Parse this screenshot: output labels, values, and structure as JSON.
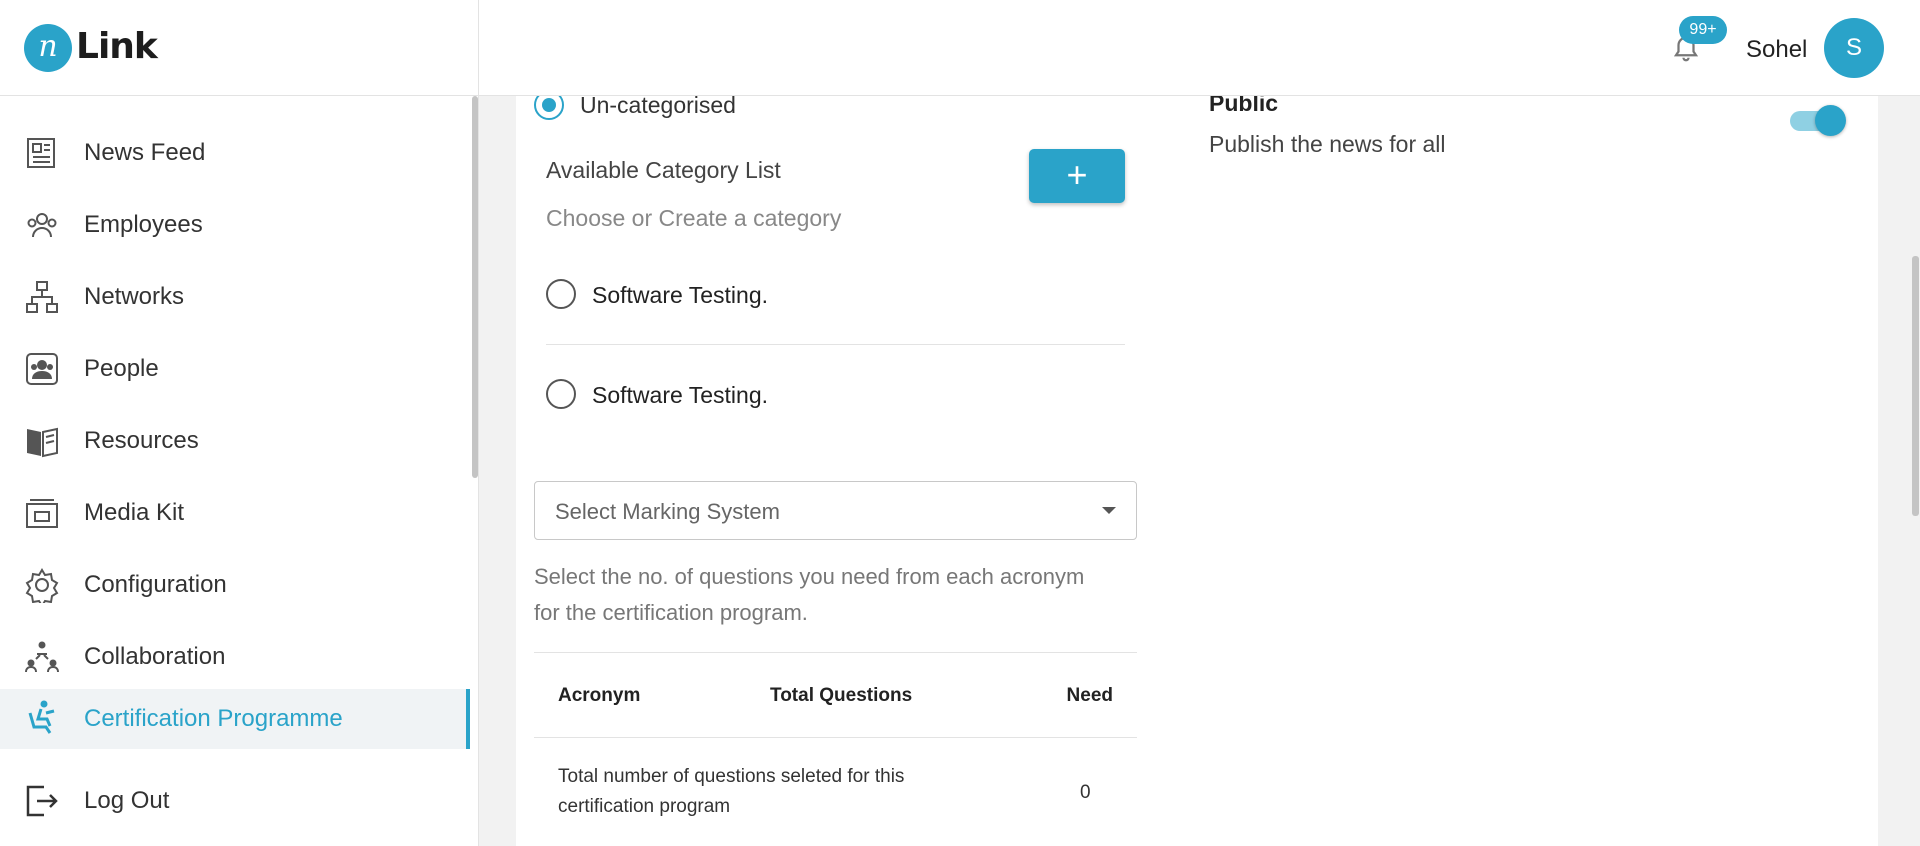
{
  "header": {
    "logo_letter": "n",
    "logo_text": "Link",
    "notification_count": "99+",
    "user_name": "Sohel",
    "avatar_initial": "S"
  },
  "sidebar": {
    "items": [
      {
        "label": "News Feed",
        "icon": "newspaper-icon",
        "active": false
      },
      {
        "label": "Employees",
        "icon": "employees-icon",
        "active": false
      },
      {
        "label": "Networks",
        "icon": "network-icon",
        "active": false
      },
      {
        "label": "People",
        "icon": "people-icon",
        "active": false
      },
      {
        "label": "Resources",
        "icon": "book-icon",
        "active": false
      },
      {
        "label": "Media Kit",
        "icon": "media-kit-icon",
        "active": false
      },
      {
        "label": "Configuration",
        "icon": "gear-icon",
        "active": false
      },
      {
        "label": "Collaboration",
        "icon": "collaboration-icon",
        "active": false
      },
      {
        "label": "Certification Programme",
        "icon": "certification-icon",
        "active": true
      },
      {
        "label": "Log Out",
        "icon": "logout-icon",
        "active": false
      }
    ]
  },
  "form": {
    "uncategorised_label": "Un-categorised",
    "uncategorised_selected": true,
    "category_list_title": "Available Category List",
    "category_list_hint": "Choose or Create a category",
    "add_category_symbol": "+",
    "categories": [
      {
        "label": "Software Testing.",
        "selected": false
      },
      {
        "label": "Software Testing.",
        "selected": false
      }
    ],
    "marking_system_placeholder": "Select Marking System",
    "questions_hint_line1": "Select the no. of questions you need from each acronym",
    "questions_hint_line2": "for the certification program."
  },
  "table": {
    "columns": [
      "Acronym",
      "Total Questions",
      "Need"
    ],
    "summary_label_line1": "Total number of questions seleted for this",
    "summary_label_line2": "certification program",
    "summary_value": "0"
  },
  "public_setting": {
    "title": "Public",
    "description": "Publish the news for all",
    "enabled": true
  },
  "colors": {
    "accent": "#2aa3c9",
    "toggle_track": "#8fd0e3"
  }
}
